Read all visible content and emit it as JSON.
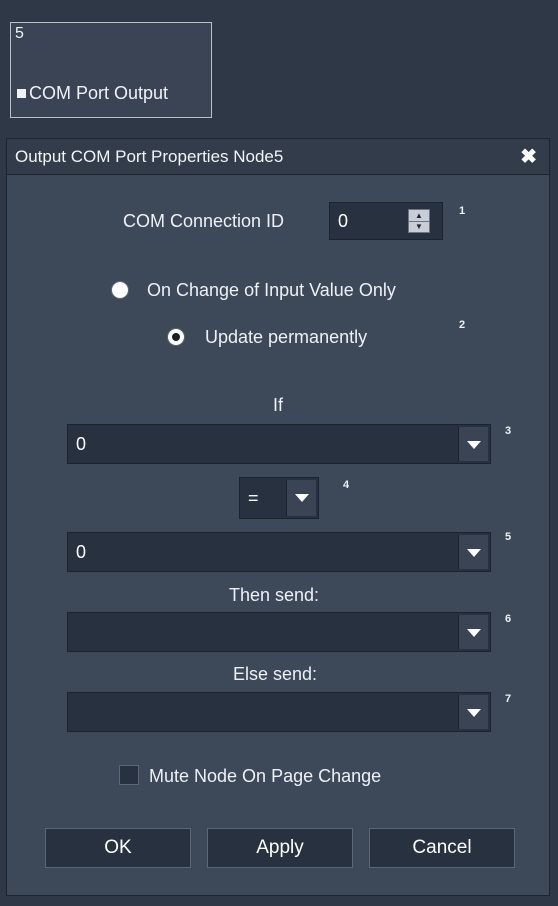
{
  "node": {
    "number": "5",
    "label": "COM Port Output"
  },
  "dialog": {
    "title": "Output COM Port Properties Node5",
    "close_symbol": "✖",
    "connection_id_label": "COM Connection ID",
    "connection_id_value": "0",
    "marker_1": "1",
    "radio_on_change": {
      "label": "On Change of Input Value Only",
      "checked": false
    },
    "radio_update": {
      "label": "Update permanently",
      "checked": true
    },
    "marker_2": "2",
    "if_label": "If",
    "if_value": "0",
    "marker_3": "3",
    "operator_value": "=",
    "marker_4": "4",
    "compare_value": "0",
    "marker_5": "5",
    "then_label": "Then send:",
    "then_value": "",
    "marker_6": "6",
    "else_label": "Else send:",
    "else_value": "",
    "marker_7": "7",
    "mute_label": "Mute Node On Page Change",
    "mute_checked": false,
    "ok_label": "OK",
    "apply_label": "Apply",
    "cancel_label": "Cancel"
  }
}
